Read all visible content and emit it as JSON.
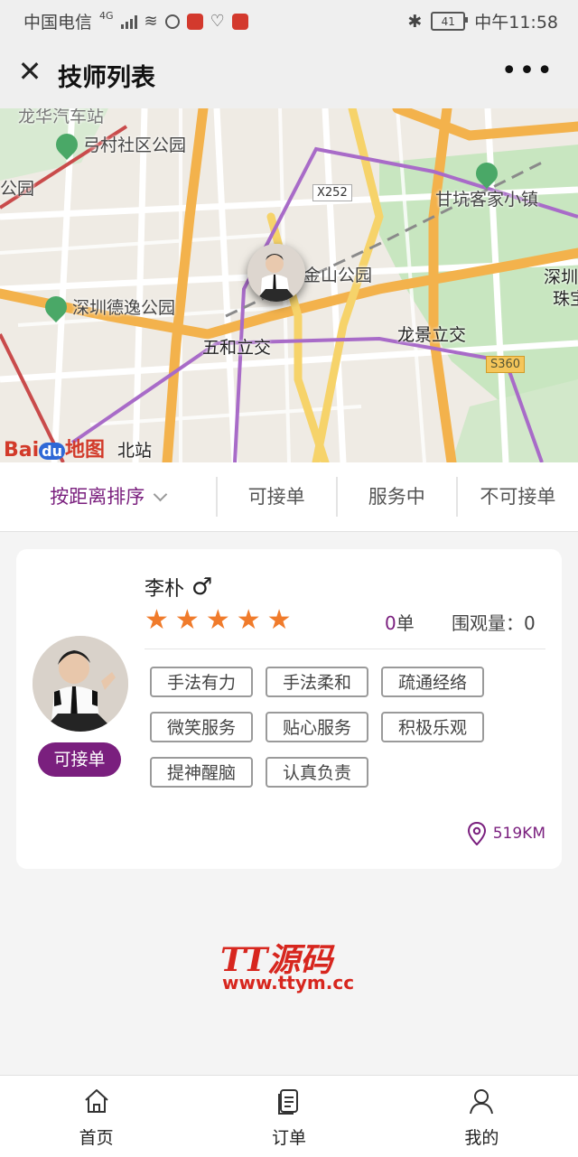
{
  "status_bar": {
    "carrier": "中国电信",
    "network": "4G",
    "battery": "41",
    "time": "中午11:58"
  },
  "nav": {
    "title": "技师列表",
    "close_icon": "close-icon",
    "more_icon": "more-icon"
  },
  "map": {
    "labels": {
      "park1": "弓村社区公园",
      "park_edge": "公园",
      "road_x252": "X252",
      "town": "甘坑客家小镇",
      "park2": "金山公园",
      "park3": "深圳德逸公园",
      "shenzhen": "深圳",
      "zhu": "珠宝",
      "interchange1": "五和立交",
      "interchange2": "龙景立交",
      "road_s360": "S360",
      "station": "北站"
    },
    "logo_text": "Bai",
    "logo_du": "du",
    "logo_suffix": "地图"
  },
  "filters": {
    "sort": "按距离排序",
    "available": "可接单",
    "in_service": "服务中",
    "unavailable": "不可接单"
  },
  "technician": {
    "name": "李朴",
    "gender_symbol": "♂",
    "rating": 5,
    "orders_count": "0",
    "orders_unit": "单",
    "views_label": "围观量：",
    "views_value": "0",
    "status": "可接单",
    "tags": [
      "手法有力",
      "手法柔和",
      "疏通经络",
      "微笑服务",
      "贴心服务",
      "积极乐观",
      "提神醒脑",
      "认真负责"
    ],
    "distance": "519KM"
  },
  "watermark": {
    "line1": "TT源码",
    "line2": "www.ttym.cc"
  },
  "tabbar": {
    "home": "首页",
    "orders": "订单",
    "mine": "我的"
  },
  "colors": {
    "accent": "#7a1f7e",
    "star": "#f07b2b"
  }
}
